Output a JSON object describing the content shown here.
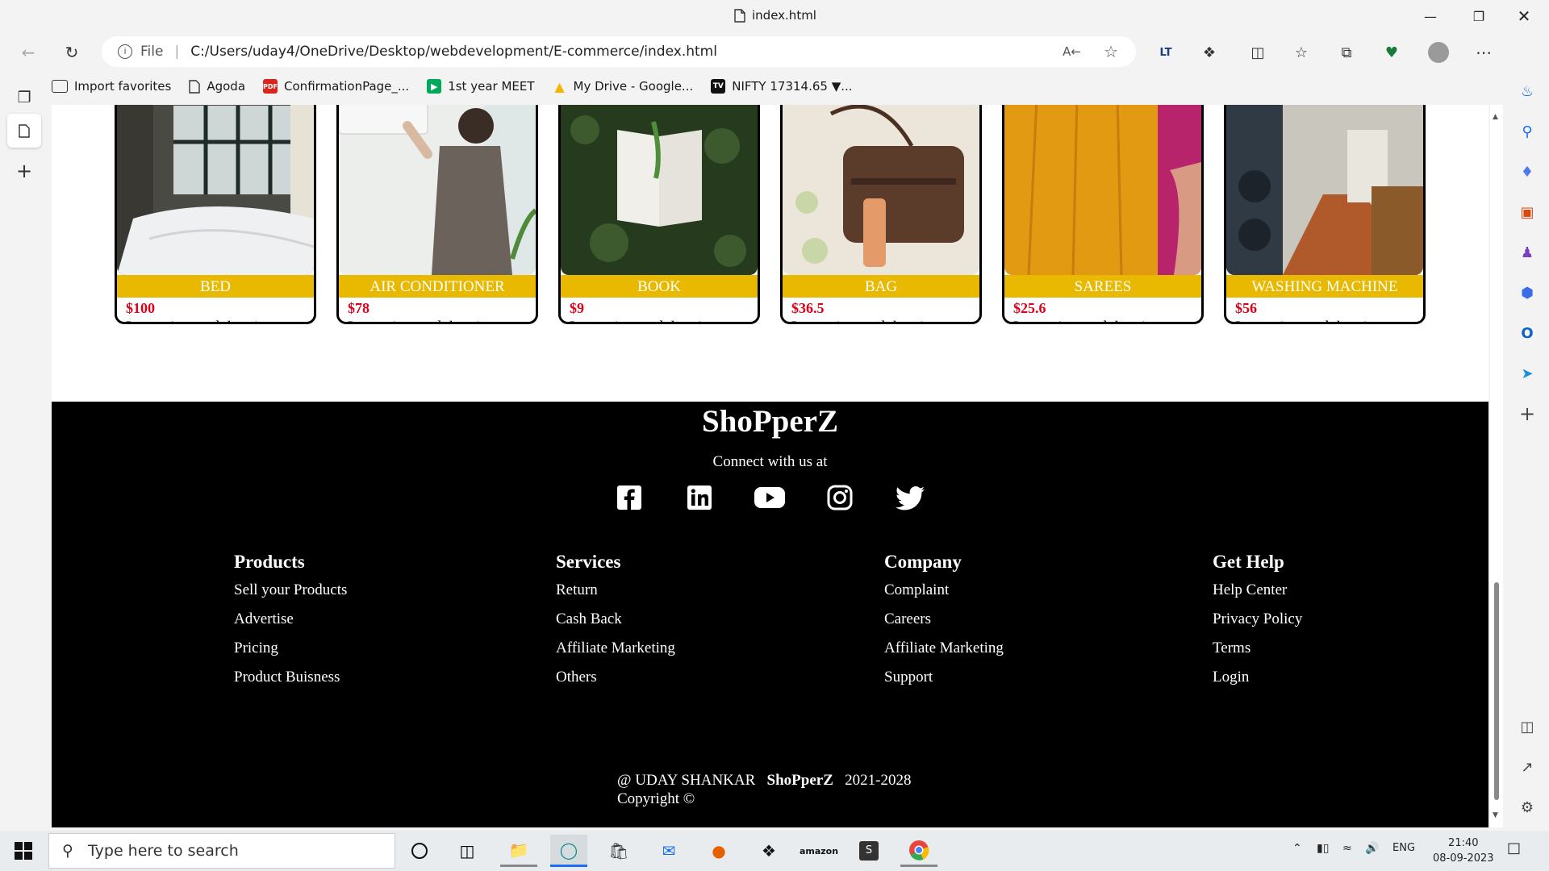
{
  "window": {
    "tab_title": "index.html"
  },
  "address": {
    "protocol_label": "File",
    "url": "C:/Users/uday4/OneDrive/Desktop/webdevelopment/E-commerce/index.html"
  },
  "favorites": [
    {
      "label": "Import favorites"
    },
    {
      "label": "Agoda"
    },
    {
      "label": "ConfirmationPage_..."
    },
    {
      "label": "1st year MEET"
    },
    {
      "label": "My Drive - Google..."
    },
    {
      "label": "NIFTY 17314.65 ▼..."
    }
  ],
  "products": [
    {
      "name": "BED",
      "price": "$100",
      "desc": "Lorem ipsum dolor sit amet consectetur, adipisicing elit."
    },
    {
      "name": "AIR CONDITIONER",
      "price": "$78",
      "desc": "Lorem ipsum dolor sit amet consectetur, adipisicing elit."
    },
    {
      "name": "BOOK",
      "price": "$9",
      "desc": "Lorem ipsum dolor sit amet consectetur, adipisicing elit."
    },
    {
      "name": "BAG",
      "price": "$36.5",
      "desc": "Lorem ipsum dolor sit amet consectetur, adipisicing elit."
    },
    {
      "name": "SAREES",
      "price": "$25.6",
      "desc": "Lorem ipsum dolor sit amet consectetur, adipisicing elit."
    },
    {
      "name": "WASHING MACHINE",
      "price": "$56",
      "desc": "Lorem ipsum dolor sit amet consectetur, adipisicing elit."
    }
  ],
  "footer": {
    "brand": "ShoPperZ",
    "connect": "Connect with us at",
    "social": [
      "facebook-icon",
      "linkedin-icon",
      "youtube-icon",
      "instagram-icon",
      "twitter-icon"
    ],
    "columns": [
      {
        "head": "Products",
        "links": [
          "Sell your Products",
          "Advertise",
          "Pricing",
          "Product Buisness"
        ]
      },
      {
        "head": "Services",
        "links": [
          "Return",
          "Cash Back",
          "Affiliate Marketing",
          "Others"
        ]
      },
      {
        "head": "Company",
        "links": [
          "Complaint",
          "Careers",
          "Affiliate Marketing",
          "Support"
        ]
      },
      {
        "head": "Get Help",
        "links": [
          "Help Center",
          "Privacy Policy",
          "Terms",
          "Login"
        ]
      }
    ],
    "copy_author": "@ UDAY SHANKAR",
    "copy_brand": "ShoPperZ",
    "copy_years": "2021-2028",
    "copy_line2": "Copyright ©"
  },
  "taskbar": {
    "search_placeholder": "Type here to search",
    "language": "ENG",
    "time": "21:40",
    "date": "08-09-2023"
  },
  "colors": {
    "accent_label": "#e8b900",
    "price": "#e0001a",
    "footer_bg": "#000000"
  }
}
